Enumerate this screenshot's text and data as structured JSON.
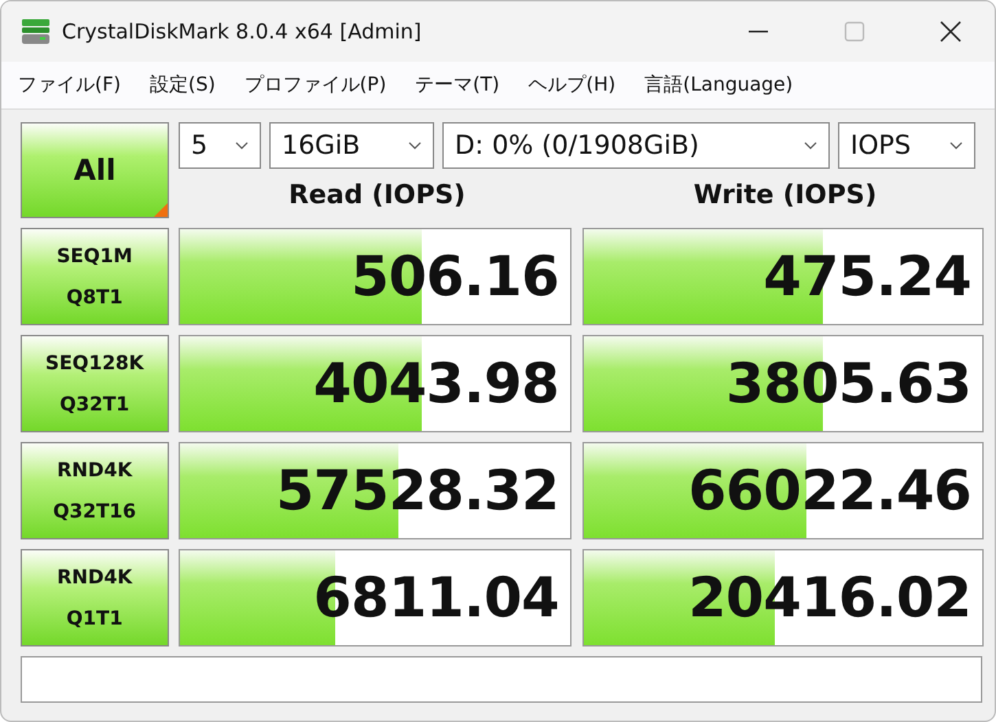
{
  "window": {
    "title": "CrystalDiskMark 8.0.4 x64 [Admin]"
  },
  "menu": [
    "ファイル(F)",
    "設定(S)",
    "プロファイル(P)",
    "テーマ(T)",
    "ヘルプ(H)",
    "言語(Language)"
  ],
  "all_button": {
    "label": "All"
  },
  "selects": [
    {
      "kind": "count",
      "value": "5"
    },
    {
      "kind": "size",
      "value": "16GiB"
    },
    {
      "kind": "drive",
      "value": "D: 0% (0/1908GiB)"
    },
    {
      "kind": "unit",
      "value": "IOPS"
    }
  ],
  "headers": [
    "Read (IOPS)",
    "Write (IOPS)"
  ],
  "rows": [
    {
      "label": [
        "SEQ1M",
        "Q8T1"
      ],
      "read": {
        "value": "506.16",
        "level": 0.62
      },
      "write": {
        "value": "475.24",
        "level": 0.6
      }
    },
    {
      "label": [
        "SEQ128K",
        "Q32T1"
      ],
      "read": {
        "value": "4043.98",
        "level": 0.62
      },
      "write": {
        "value": "3805.63",
        "level": 0.6
      }
    },
    {
      "label": [
        "RND4K",
        "Q32T16"
      ],
      "read": {
        "value": "57528.32",
        "level": 0.56
      },
      "write": {
        "value": "66022.46",
        "level": 0.56
      }
    },
    {
      "label": [
        "RND4K",
        "Q1T1"
      ],
      "read": {
        "value": "6811.04",
        "level": 0.4
      },
      "write": {
        "value": "20416.02",
        "level": 0.48
      }
    }
  ]
}
